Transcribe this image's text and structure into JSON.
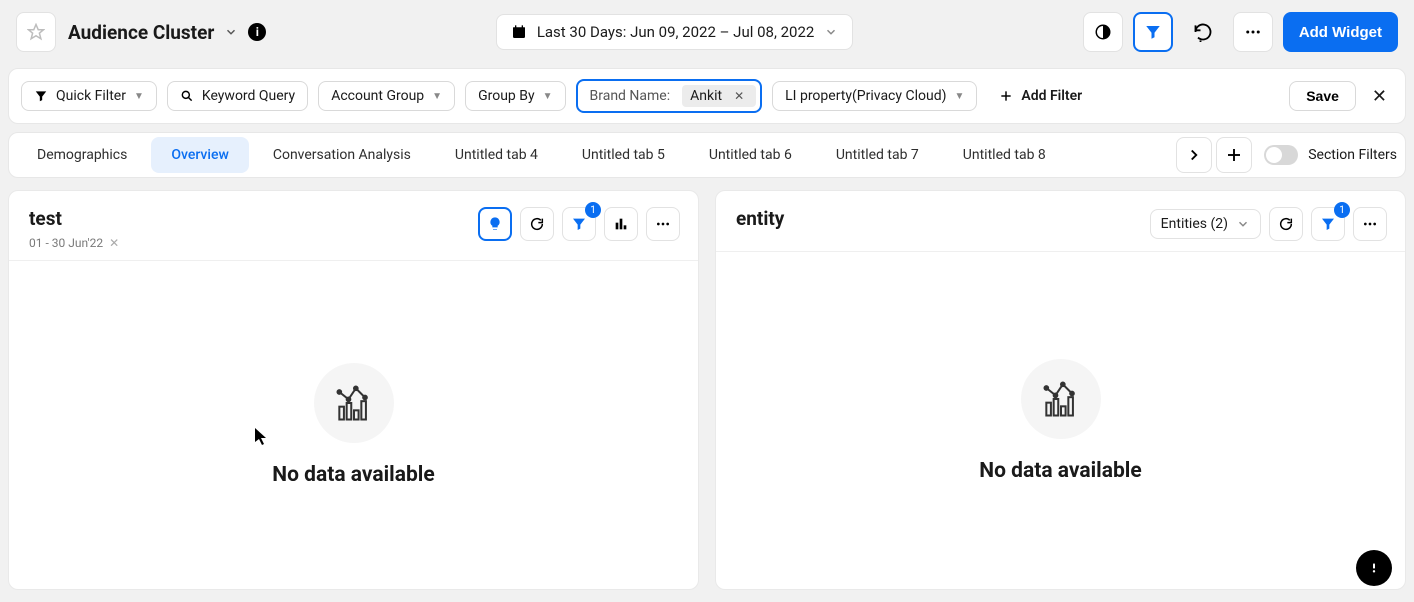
{
  "header": {
    "title": "Audience Cluster",
    "date_range": "Last 30 Days: Jun 09, 2022 – Jul 08, 2022",
    "add_widget": "Add Widget"
  },
  "filters": {
    "quick_filter": "Quick Filter",
    "keyword_query": "Keyword Query",
    "account_group": "Account Group",
    "group_by": "Group By",
    "brand_label": "Brand Name:",
    "brand_value": "Ankit",
    "li_property": "LI property(Privacy Cloud)",
    "add_filter": "Add Filter",
    "save": "Save"
  },
  "tabs": {
    "items": [
      {
        "label": "Demographics",
        "active": false
      },
      {
        "label": "Overview",
        "active": true
      },
      {
        "label": "Conversation Analysis",
        "active": false
      },
      {
        "label": "Untitled tab 4",
        "active": false
      },
      {
        "label": "Untitled tab 5",
        "active": false
      },
      {
        "label": "Untitled tab 6",
        "active": false
      },
      {
        "label": "Untitled tab 7",
        "active": false
      },
      {
        "label": "Untitled tab 8",
        "active": false
      }
    ],
    "section_filters": "Section Filters"
  },
  "widgets": {
    "left": {
      "title": "test",
      "subtitle": "01 - 30 Jun'22",
      "filter_badge": "1",
      "empty": "No data available"
    },
    "right": {
      "title": "entity",
      "entities_label": "Entities (2)",
      "filter_badge": "1",
      "empty": "No data available"
    }
  }
}
